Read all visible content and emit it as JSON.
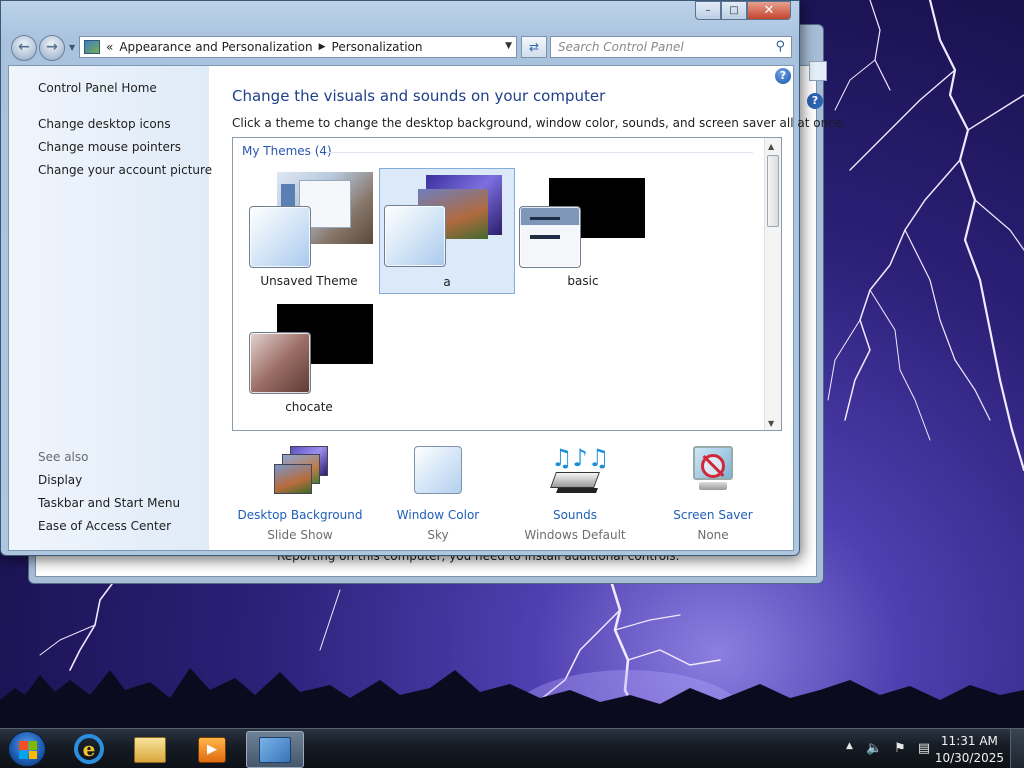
{
  "window": {
    "caption": {
      "minimize": "–",
      "maximize": "□",
      "close": "✕"
    }
  },
  "address_bar": {
    "overflow": "«",
    "breadcrumbs": [
      "Appearance and Personalization",
      "Personalization"
    ],
    "search_placeholder": "Search Control Panel"
  },
  "sidebar": {
    "home": "Control Panel Home",
    "links": [
      "Change desktop icons",
      "Change mouse pointers",
      "Change your account picture"
    ],
    "see_also_label": "See also",
    "see_also": [
      "Display",
      "Taskbar and Start Menu",
      "Ease of Access Center"
    ]
  },
  "main": {
    "help": "?",
    "heading": "Change the visuals and sounds on your computer",
    "subtext": "Click a theme to change the desktop background, window color, sounds, and screen saver all at once.",
    "group_label": "My Themes (4)",
    "themes": [
      {
        "name": "Unsaved Theme",
        "selected": false
      },
      {
        "name": "a",
        "selected": true
      },
      {
        "name": "basic",
        "selected": false
      },
      {
        "name": "chocate",
        "selected": false
      }
    ],
    "features": [
      {
        "label": "Desktop Background",
        "value": "Slide Show",
        "icon": "desktop-background-icon"
      },
      {
        "label": "Window Color",
        "value": "Sky",
        "icon": "window-color-icon"
      },
      {
        "label": "Sounds",
        "value": "Windows Default",
        "icon": "sounds-icon"
      },
      {
        "label": "Screen Saver",
        "value": "None",
        "icon": "screen-saver-icon"
      }
    ]
  },
  "background_window": {
    "partial_text": "Reporting on this computer, you need to install additional controls."
  },
  "taskbar": {
    "pinned": [
      "internet-explorer-icon",
      "windows-explorer-icon",
      "media-player-icon",
      "control-panel-icon"
    ],
    "clock": {
      "time": "11:31 AM",
      "date": "10/30/2025"
    }
  },
  "colors": {
    "link": "#1f5fb8",
    "heading": "#1e3f8a",
    "selected_tile": "#dbe9f9",
    "sidebar": "#e6effa"
  }
}
